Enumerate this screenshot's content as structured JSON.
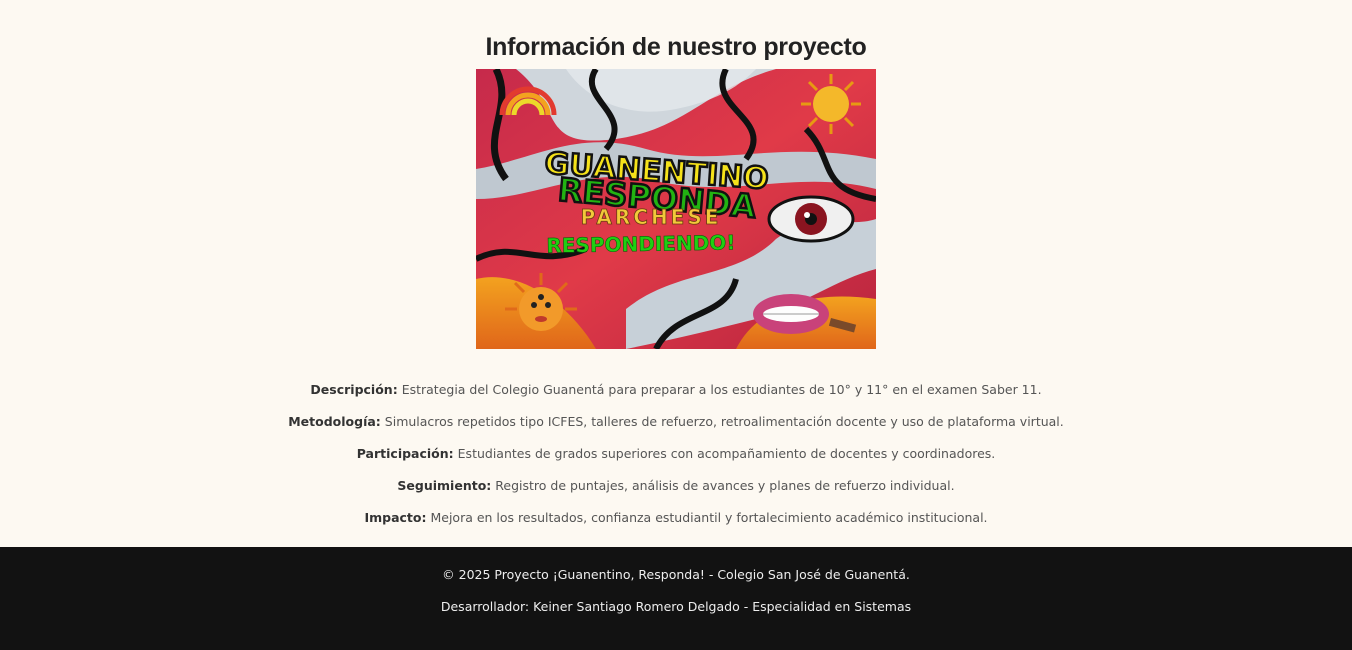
{
  "project": {
    "title": "Información de nuestro proyecto",
    "poster": {
      "line1": "GUANENTINO",
      "line2": "RESPONDA",
      "line3": "PARCHESE",
      "line4": "RESPONDIENDO!",
      "colors": {
        "background": "#d8324a",
        "title_fill": "#f5e21a",
        "title_green": "#22b312",
        "outline": "#111111",
        "orange": "#f08a1c"
      }
    },
    "items": [
      {
        "label": "Descripción:",
        "text": "Estrategia del Colegio Guanentá para preparar a los estudiantes de 10° y 11° en el examen Saber 11."
      },
      {
        "label": "Metodología:",
        "text": "Simulacros repetidos tipo ICFES, talleres de refuerzo, retroalimentación docente y uso de plataforma virtual."
      },
      {
        "label": "Participación:",
        "text": "Estudiantes de grados superiores con acompañamiento de docentes y coordinadores."
      },
      {
        "label": "Seguimiento:",
        "text": "Registro de puntajes, análisis de avances y planes de refuerzo individual."
      },
      {
        "label": "Impacto:",
        "text": "Mejora en los resultados, confianza estudiantil y fortalecimiento académico institucional."
      }
    ]
  },
  "footer": {
    "copyright": "© 2025 Proyecto ¡Guanentino, Responda! - Colegio San José de Guanentá.",
    "developer": "Desarrollador: Keiner Santiago Romero Delgado - Especialidad en Sistemas"
  },
  "colors": {
    "page_background": "#fdf9f2",
    "footer_background": "#121212",
    "footer_text": "#eeeeee",
    "body_text": "#555555",
    "title_text": "#222222"
  }
}
